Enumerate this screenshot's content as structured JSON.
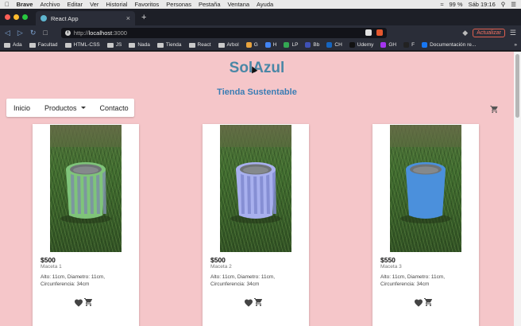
{
  "os_menubar": {
    "apple": "",
    "app_name": "Brave",
    "menus": [
      "Archivo",
      "Editar",
      "Ver",
      "Historial",
      "Favoritos",
      "Personas",
      "Pestaña",
      "Ventana",
      "Ayuda"
    ],
    "battery": "99 %",
    "clock": "Sáb 19:16"
  },
  "browser": {
    "tab_title": "React App",
    "url_scheme": "http://",
    "url_host": "localhost",
    "url_port": ":3000",
    "update_label": "Actualizar",
    "bookmarks": [
      {
        "label": "Ada",
        "icon": "folder"
      },
      {
        "label": "Facultad",
        "icon": "folder"
      },
      {
        "label": "HTML-CSS",
        "icon": "folder"
      },
      {
        "label": "JS",
        "icon": "folder"
      },
      {
        "label": "Nada",
        "icon": "folder"
      },
      {
        "label": "Tienda",
        "icon": "folder"
      },
      {
        "label": "React",
        "icon": "folder"
      },
      {
        "label": "Arbol",
        "icon": "folder"
      },
      {
        "label": "G",
        "icon": "site"
      },
      {
        "label": "H",
        "icon": "site"
      },
      {
        "label": "LP",
        "icon": "site"
      },
      {
        "label": "Bb",
        "icon": "site"
      },
      {
        "label": "CH",
        "icon": "site"
      },
      {
        "label": "Udemy",
        "icon": "site"
      },
      {
        "label": "GH",
        "icon": "site"
      },
      {
        "label": "F",
        "icon": "site"
      },
      {
        "label": "Documentación re...",
        "icon": "site"
      }
    ]
  },
  "site": {
    "brand": "SolAzul",
    "subtitle": "Tienda Sustentable",
    "nav": {
      "home": "Inicio",
      "products": "Productos",
      "contact": "Contacto"
    },
    "products": [
      {
        "price": "$500",
        "name": "Maceta 1",
        "desc": "Alto: 11cm, Diametro: 11cm, Circunferencia: 34cm",
        "pot_color": "#7fc47a",
        "stripe_color": "#7b8fa6"
      },
      {
        "price": "$500",
        "name": "Maceta 2",
        "desc": "Alto: 11cm, Diametro: 11cm, Circunferencia: 34cm",
        "pot_color": "#a8b0ee",
        "stripe_color": "#8089cf"
      },
      {
        "price": "$550",
        "name": "Maceta 3",
        "desc": "Alto: 11cm, Diametro: 11cm, Circunferencia: 34cm",
        "pot_color": "#4b90dc",
        "stripe_color": "#3c7cc8"
      }
    ]
  },
  "colors": {
    "page_bg": "#f5c6c9",
    "brand": "#4a87a6",
    "subtitle": "#3b7db4"
  }
}
